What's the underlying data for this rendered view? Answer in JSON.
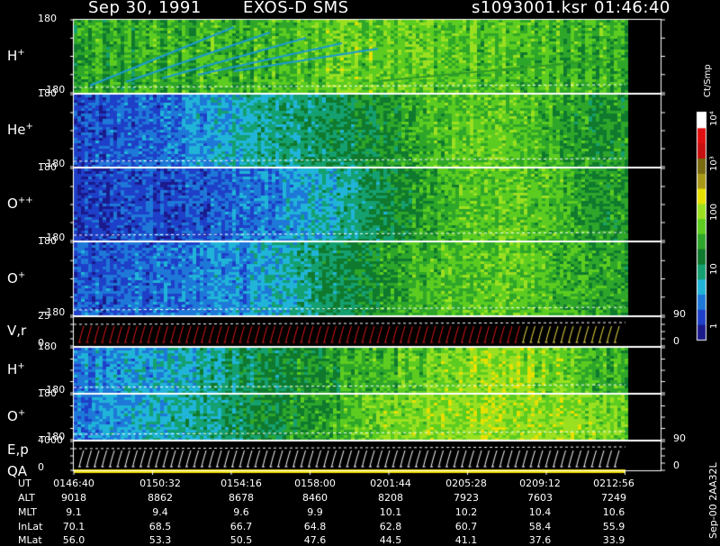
{
  "header": {
    "date": "Sep 30, 1991",
    "instrument": "EXOS-D SMS",
    "file": "s1093001.ksr",
    "time": "01:46:40"
  },
  "panels": [
    {
      "label": "H",
      "sup": "+",
      "ymax": "180",
      "ymin": "−180"
    },
    {
      "label": "He",
      "sup": "+",
      "ymax": "180",
      "ymin": "−180"
    },
    {
      "label": "O",
      "sup": "++",
      "ymax": "180",
      "ymin": "−180"
    },
    {
      "label": "O",
      "sup": "+",
      "ymax": "180",
      "ymin": "−180"
    },
    {
      "label": "V,r",
      "sup": "",
      "ymax": "25",
      "ymin": "0",
      "rmax": "90",
      "rmin": "0"
    },
    {
      "label": "H",
      "sup": "+",
      "ymax": "180",
      "ymin": "−180"
    },
    {
      "label": "O",
      "sup": "+",
      "ymax": "180",
      "ymin": "−180"
    },
    {
      "label": "E,p",
      "label2": "QA",
      "sup": "",
      "ymax": "4000",
      "ymin": "0",
      "rmax": "90",
      "rmin": "0"
    }
  ],
  "colorbar": {
    "unit": "Ct/Smp",
    "ticks": [
      "10⁴",
      "10³",
      "100",
      "10",
      "1"
    ]
  },
  "footer_id": "Sep-00 2AA32L",
  "ephemeris": {
    "labels": [
      "UT",
      "ALT",
      "MLT",
      "InLat",
      "MLat"
    ],
    "columns": [
      [
        "0146:40",
        "9018",
        "9.1",
        "70.1",
        "56.0"
      ],
      [
        "0150:32",
        "8862",
        "9.4",
        "68.5",
        "53.3"
      ],
      [
        "0154:16",
        "8678",
        "9.6",
        "66.7",
        "50.5"
      ],
      [
        "0158:00",
        "8460",
        "9.9",
        "64.8",
        "47.6"
      ],
      [
        "0201:44",
        "8208",
        "10.1",
        "62.8",
        "44.5"
      ],
      [
        "0205:28",
        "7923",
        "10.2",
        "60.7",
        "41.1"
      ],
      [
        "0209:12",
        "7603",
        "10.4",
        "58.4",
        "37.6"
      ],
      [
        "0212:56",
        "7249",
        "10.6",
        "55.9",
        "33.9"
      ]
    ]
  },
  "chart_data": {
    "type": "heatmap",
    "x_ticks": [
      "0146:40",
      "0150:32",
      "0154:16",
      "0158:00",
      "0201:44",
      "0205:28",
      "0209:12",
      "0212:56"
    ],
    "colorscale": [
      "#1a1a8c",
      "#1e40c8",
      "#1e78d8",
      "#20b4d8",
      "#14a070",
      "#0f7a2e",
      "#2ea62a",
      "#5ccc20",
      "#9be020",
      "#e6e000",
      "#a89a18",
      "#7a6a10",
      "#c81010",
      "#e01010",
      "#ffffff"
    ],
    "series": [
      {
        "name": "H+",
        "ylim": [
          -180,
          180
        ],
        "level_profile": [
          0.58,
          0.58,
          0.58,
          0.6,
          0.6,
          0.62,
          0.68,
          0.68,
          0.66,
          0.66,
          0.64,
          0.62,
          0.6,
          0.6
        ]
      },
      {
        "name": "He+",
        "ylim": [
          -180,
          180
        ],
        "level_profile": [
          0.1,
          0.12,
          0.16,
          0.22,
          0.3,
          0.36,
          0.4,
          0.46,
          0.56,
          0.62,
          0.62,
          0.58,
          0.52,
          0.48
        ]
      },
      {
        "name": "O++",
        "ylim": [
          -180,
          180
        ],
        "level_profile": [
          0.06,
          0.08,
          0.1,
          0.12,
          0.16,
          0.22,
          0.3,
          0.4,
          0.52,
          0.6,
          0.64,
          0.6,
          0.54,
          0.5
        ]
      },
      {
        "name": "O+",
        "ylim": [
          -180,
          180
        ],
        "level_profile": [
          0.12,
          0.14,
          0.16,
          0.18,
          0.22,
          0.3,
          0.4,
          0.48,
          0.56,
          0.62,
          0.64,
          0.6,
          0.56,
          0.52
        ]
      },
      {
        "name": "H+ (lower)",
        "ylim": [
          -180,
          180
        ],
        "level_profile": [
          0.2,
          0.24,
          0.3,
          0.36,
          0.42,
          0.48,
          0.54,
          0.6,
          0.64,
          0.72,
          0.74,
          0.72,
          0.62,
          0.58
        ]
      },
      {
        "name": "O+ (lower)",
        "ylim": [
          -180,
          180
        ],
        "level_profile": [
          0.16,
          0.22,
          0.28,
          0.34,
          0.42,
          0.48,
          0.56,
          0.64,
          0.7,
          0.72,
          0.72,
          0.7,
          0.68,
          0.62
        ]
      }
    ]
  }
}
